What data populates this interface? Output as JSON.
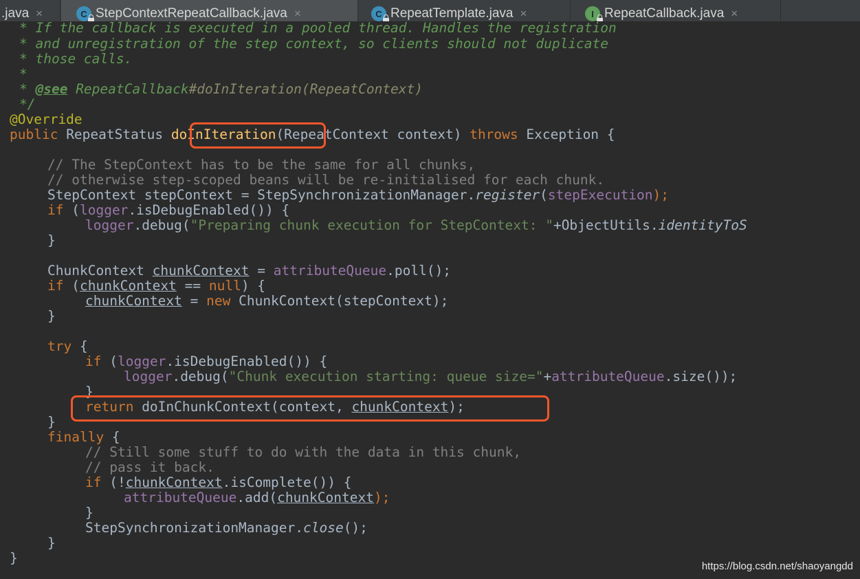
{
  "tabs": [
    {
      "name": ".java",
      "icon": "none",
      "active": false
    },
    {
      "name": "StepContextRepeatCallback.java",
      "icon": "class-icon",
      "active": true
    },
    {
      "name": "RepeatTemplate.java",
      "icon": "class-icon",
      "active": false
    },
    {
      "name": "RepeatCallback.java",
      "icon": "interface-icon",
      "active": false
    }
  ],
  "tab_close_glyph": "×",
  "icon_letters": {
    "class": "C",
    "interface": "I"
  },
  "code": {
    "l1": "* If the callback is executed in a pooled thread. Handles the registration",
    "l2": "* and unregistration of the step context, so clients should not duplicate",
    "l3": "* those calls.",
    "l4": "*",
    "l5a": "* ",
    "l5b": "@see",
    "l5c": " RepeatCallback",
    "l5d": "#doInIteration(RepeatContext)",
    "l6": "*/",
    "l7": "@Override",
    "l8a": "public ",
    "l8b": "RepeatStatus ",
    "l8c": "doInIteration",
    "l8d": "(RepeatContext context) ",
    "l8e": "throws ",
    "l8f": "Exception {",
    "l10": "// The StepContext has to be the same for all chunks,",
    "l11": "// otherwise step-scoped beans will be re-initialised for each chunk.",
    "l12a": "StepContext stepContext = StepSynchronizationManager.",
    "l12b": "register",
    "l12c": "(",
    "l12d": "stepExecution",
    "l12e": ");",
    "l13a": "if ",
    "l13b": "(",
    "l13c": "logger",
    "l13d": ".isDebugEnabled()) {",
    "l14a": "logger",
    "l14b": ".debug(",
    "l14c": "\"Preparing chunk execution for StepContext: \"",
    "l14d": "+ObjectUtils.",
    "l14e": "identityToS",
    "l15": "}",
    "l17a": "ChunkContext ",
    "l17b": "chunkContext",
    "l17c": " = ",
    "l17d": "attributeQueue",
    "l17e": ".poll();",
    "l18a": "if ",
    "l18b": "(",
    "l18c": "chunkContext",
    "l18d": " == ",
    "l18e": "null",
    "l18f": ") {",
    "l19a": "chunkContext",
    "l19b": " = ",
    "l19c": "new ",
    "l19d": "ChunkContext(stepContext);",
    "l20": "}",
    "l22a": "try ",
    "l22b": "{",
    "l23a": "if ",
    "l23b": "(",
    "l23c": "logger",
    "l23d": ".isDebugEnabled()) {",
    "l24a": "logger",
    "l24b": ".debug(",
    "l24c": "\"Chunk execution starting: queue size=\"",
    "l24d": "+",
    "l24e": "attributeQueue",
    "l24f": ".size());",
    "l25": "}",
    "l26a": "return ",
    "l26b": "doInChunkContext(context, ",
    "l26c": "chunkContext",
    "l26d": ");",
    "l27": "}",
    "l28a": "finally ",
    "l28b": "{",
    "l29": "// Still some stuff to do with the data in this chunk,",
    "l30": "// pass it back.",
    "l31a": "if ",
    "l31b": "(!",
    "l31c": "chunkContext",
    "l31d": ".isComplete()) {",
    "l32a": "attributeQueue",
    "l32b": ".add(",
    "l32c": "chunkContext",
    "l32d": ");",
    "l33": "}",
    "l34a": "StepSynchronizationManager.",
    "l34b": "close",
    "l34c": "();",
    "l35": "}",
    "l36": "}"
  },
  "watermark": "https://blog.csdn.net/shaoyangdd",
  "colors": {
    "background": "#2b2b2b",
    "keyword": "#cc7832",
    "string": "#6a8759",
    "field": "#9876aa",
    "comment": "#808080",
    "javadoc": "#629755",
    "annotation": "#bbb529",
    "highlight_box": "#f2572b"
  }
}
